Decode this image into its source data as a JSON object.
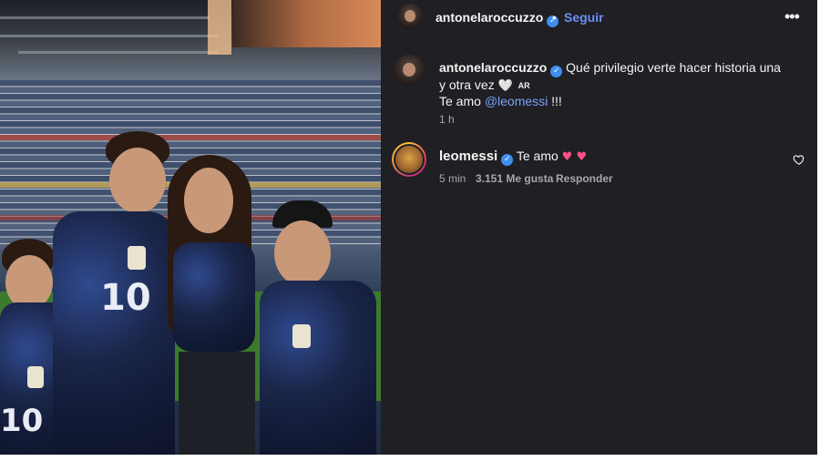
{
  "post": {
    "author": "antonelaroccuzzo",
    "follow_label": "Seguir",
    "separator": "•",
    "more_label": "•••"
  },
  "caption": {
    "author": "antonelaroccuzzo",
    "text_line1": "Qué privilegio verte hacer historia una",
    "text_line2": "y otra vez",
    "heart": "🤍",
    "flag": "AR",
    "text_line3_prefix": "Te amo",
    "mention": "@leomessi",
    "text_line3_suffix": "!!!",
    "time": "1 h"
  },
  "comment": {
    "author": "leomessi",
    "text": "Te amo",
    "hearts": "♥ ♥",
    "time": "5 min",
    "likes": "3.151 Me gusta",
    "reply_label": "Responder"
  },
  "photo": {
    "jersey_numbers": [
      "10",
      "10"
    ]
  },
  "colors": {
    "panel_bg": "#1f1f24",
    "link": "#6c8ff7",
    "verified": "#3f8df0",
    "heart": "#ff4f86"
  }
}
